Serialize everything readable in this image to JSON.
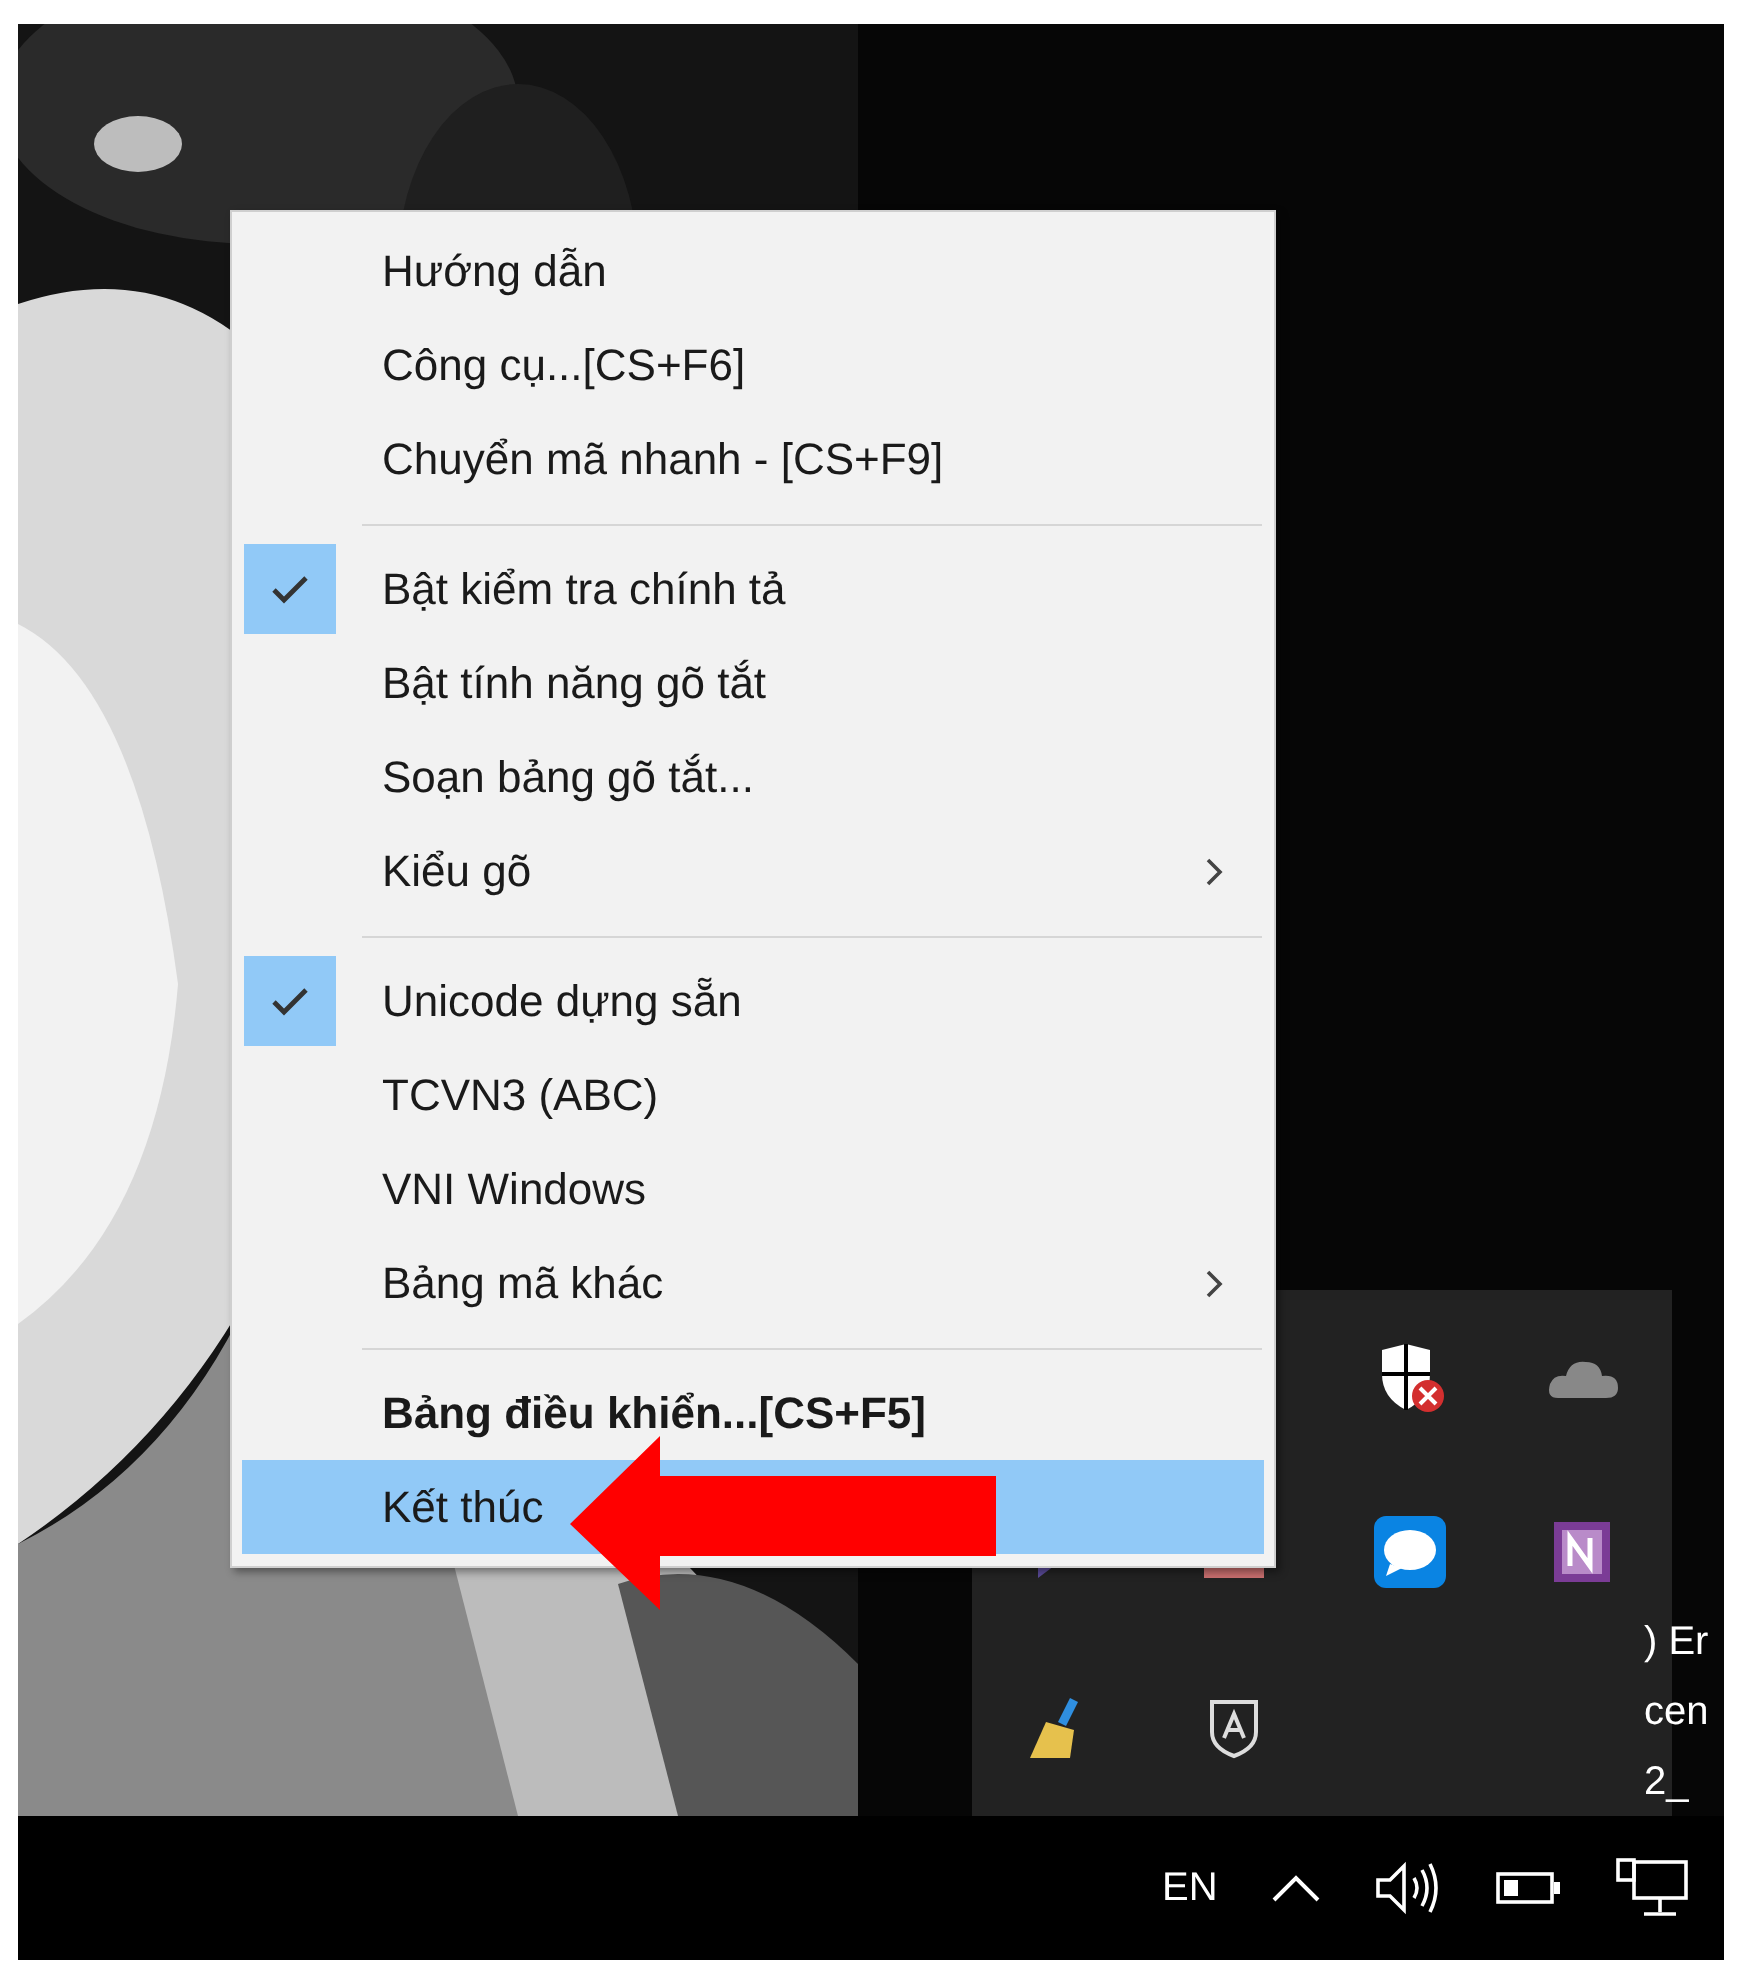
{
  "menu": {
    "items": [
      {
        "kind": "item",
        "label": "Hướng dẫn",
        "checked": false,
        "submenu": false,
        "bold": false,
        "selected": false
      },
      {
        "kind": "item",
        "label": "Công cụ...[CS+F6]",
        "checked": false,
        "submenu": false,
        "bold": false,
        "selected": false
      },
      {
        "kind": "item",
        "label": "Chuyển mã nhanh - [CS+F9]",
        "checked": false,
        "submenu": false,
        "bold": false,
        "selected": false
      },
      {
        "kind": "separator"
      },
      {
        "kind": "item",
        "label": "Bật kiểm tra chính tả",
        "checked": true,
        "submenu": false,
        "bold": false,
        "selected": false
      },
      {
        "kind": "item",
        "label": "Bật tính năng gõ tắt",
        "checked": false,
        "submenu": false,
        "bold": false,
        "selected": false
      },
      {
        "kind": "item",
        "label": "Soạn bảng gõ tắt...",
        "checked": false,
        "submenu": false,
        "bold": false,
        "selected": false
      },
      {
        "kind": "item",
        "label": "Kiểu gõ",
        "checked": false,
        "submenu": true,
        "bold": false,
        "selected": false
      },
      {
        "kind": "separator"
      },
      {
        "kind": "item",
        "label": "Unicode dựng sẵn",
        "checked": true,
        "submenu": false,
        "bold": false,
        "selected": false
      },
      {
        "kind": "item",
        "label": "TCVN3 (ABC)",
        "checked": false,
        "submenu": false,
        "bold": false,
        "selected": false
      },
      {
        "kind": "item",
        "label": "VNI Windows",
        "checked": false,
        "submenu": false,
        "bold": false,
        "selected": false
      },
      {
        "kind": "item",
        "label": "Bảng mã khác",
        "checked": false,
        "submenu": true,
        "bold": false,
        "selected": false
      },
      {
        "kind": "separator"
      },
      {
        "kind": "item",
        "label": "Bảng điều khiển...[CS+F5]",
        "checked": false,
        "submenu": false,
        "bold": true,
        "selected": false
      },
      {
        "kind": "item",
        "label": "Kết thúc",
        "checked": false,
        "submenu": false,
        "bold": false,
        "selected": true
      }
    ]
  },
  "desktop_text": [
    ") Er",
    "cen",
    "2_"
  ],
  "taskbar": {
    "language": "EN"
  }
}
